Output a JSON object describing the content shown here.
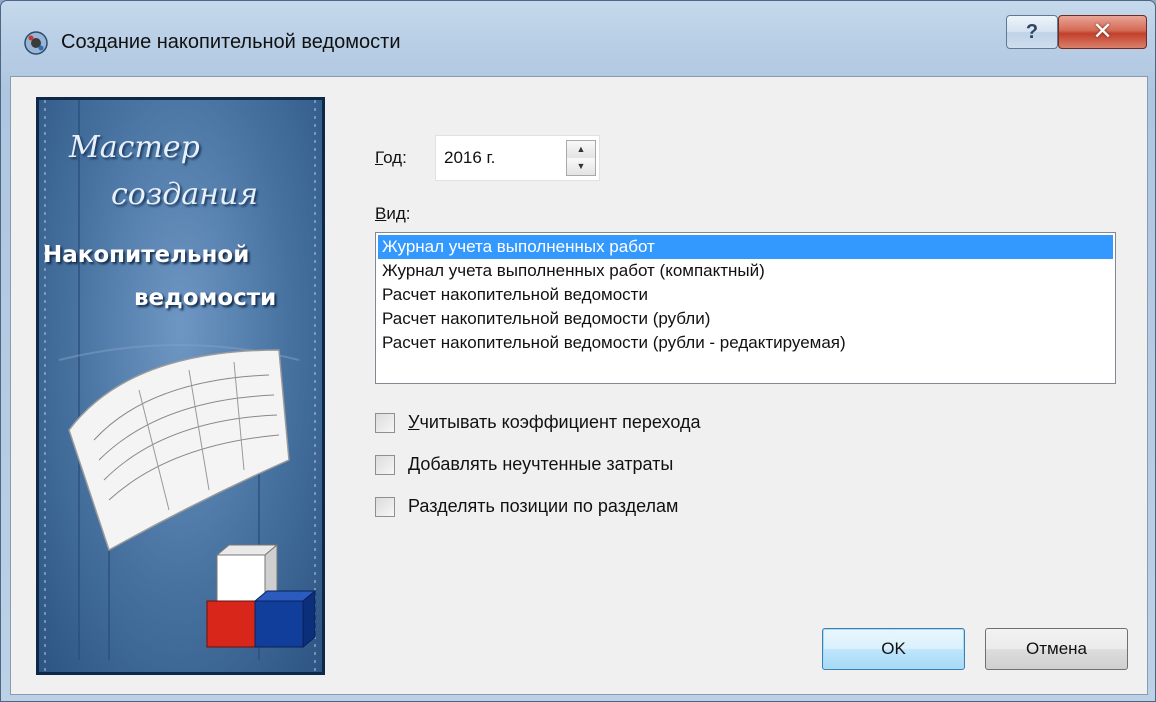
{
  "window": {
    "title": "Создание накопительной ведомости",
    "help_glyph": "?",
    "close_glyph": "✕"
  },
  "banner": {
    "line1": "Мастер",
    "line2": "создания",
    "line3": "Накопительной",
    "line4": "ведомости"
  },
  "year": {
    "label_accel": "Г",
    "label_rest": "од:",
    "value": "2016 г.",
    "up_glyph": "▲",
    "down_glyph": "▼"
  },
  "kind": {
    "label_accel": "В",
    "label_rest": "ид:",
    "items": [
      "Журнал учета выполненных работ",
      "Журнал учета выполненных работ (компактный)",
      "Расчет накопительной ведомости",
      "Расчет накопительной ведомости (рубли)",
      "Расчет накопительной ведомости (рубли - редактируемая)"
    ],
    "selected_index": 0
  },
  "options": [
    {
      "accel": "У",
      "rest": "читывать коэффициент перехода",
      "checked": false
    },
    {
      "accel": "Д",
      "rest": "обавлять неучтенные затраты",
      "checked": false
    },
    {
      "accel": "",
      "rest": "Разделять позиции по разделам",
      "checked": false
    }
  ],
  "buttons": {
    "ok": "OK",
    "cancel": "Отмена"
  },
  "colors": {
    "selection": "#3399ff",
    "banner_blue": "#46719f",
    "close_red": "#c2402c"
  }
}
